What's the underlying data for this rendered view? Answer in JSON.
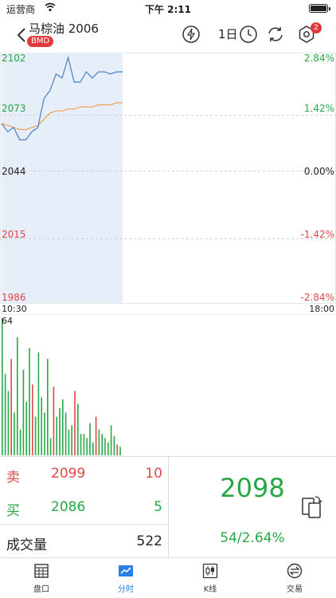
{
  "status_bar": {
    "carrier": "运营商",
    "time": "下午 2:11"
  },
  "header": {
    "title": "马棕油 2006",
    "exchange_badge": "BMD",
    "period": "1日",
    "notification_count": "2",
    "colors": {
      "badge": "#e33b3b",
      "icon": "#333333"
    }
  },
  "chart": {
    "price_labels": [
      "2102",
      "2073",
      "2044",
      "2015",
      "1986"
    ],
    "pct_labels": [
      "2.84%",
      "1.42%",
      "0.00%",
      "-1.42%",
      "-2.84%"
    ],
    "time_start": "10:30",
    "time_end": "18:00",
    "volume_max": "64",
    "colors": {
      "up": "#27a844",
      "down": "#e04848",
      "price_line": "#4a7fc1",
      "avg_line": "#f0a050",
      "fill": "#e6eefa"
    }
  },
  "chart_data": {
    "type": "line",
    "ylim": [
      1986,
      2102
    ],
    "series": [
      {
        "values": [
          2070,
          2066,
          2068,
          2062,
          2062,
          2066,
          2068,
          2082,
          2086,
          2094,
          2092,
          2102,
          2090,
          2090,
          2095,
          2092,
          2095,
          2095,
          2094,
          2095,
          2095
        ]
      },
      {
        "values": [
          2070,
          2069,
          2068,
          2067,
          2067,
          2068,
          2069,
          2072,
          2075,
          2076,
          2076,
          2077,
          2077,
          2078,
          2078,
          2078,
          2079,
          2079,
          2079,
          2080,
          2080
        ]
      }
    ],
    "volume": [
      64,
      38,
      30,
      45,
      20,
      55,
      12,
      40,
      25,
      50,
      33,
      18,
      48,
      27,
      20,
      45,
      8,
      32,
      18,
      22,
      26,
      20,
      12,
      14,
      30,
      24,
      10,
      10,
      8,
      15,
      6,
      18,
      12,
      10,
      8,
      6,
      14,
      9,
      5,
      4
    ],
    "volume_ylim": [
      0,
      64
    ]
  },
  "quote": {
    "sell_label": "卖",
    "sell_price": "2099",
    "sell_qty": "10",
    "buy_label": "买",
    "buy_price": "2086",
    "buy_qty": "5",
    "volume_label": "成交量",
    "volume_value": "522",
    "last_price": "2098",
    "change": "54/2.64%"
  },
  "tabs": [
    {
      "label": "盘口",
      "icon": "grid-icon"
    },
    {
      "label": "分时",
      "icon": "timeshare-chart-icon"
    },
    {
      "label": "K线",
      "icon": "candlestick-icon"
    },
    {
      "label": "交易",
      "icon": "exchange-icon"
    }
  ]
}
